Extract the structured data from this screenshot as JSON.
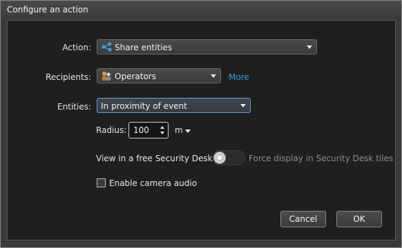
{
  "window": {
    "title": "Configure an action"
  },
  "action": {
    "label": "Action:",
    "value": "Share entities",
    "icon": "share-icon"
  },
  "recipients": {
    "label": "Recipients:",
    "value": "Operators",
    "icon": "operators-icon",
    "more_link": "More"
  },
  "entities": {
    "label": "Entities:",
    "value": "In proximity of event"
  },
  "radius": {
    "label": "Radius:",
    "value": "100",
    "unit": "m"
  },
  "tile_option": {
    "left_label": "View in a free Security Desk tile",
    "right_label": "Force display in Security Desk tiles",
    "state": "left"
  },
  "camera_audio": {
    "label": "Enable camera audio",
    "checked": false
  },
  "buttons": {
    "cancel": "Cancel",
    "ok": "OK"
  },
  "colors": {
    "link": "#2f9ff0",
    "focus_border": "#5ea0e8",
    "background": "#1f1f1f"
  }
}
